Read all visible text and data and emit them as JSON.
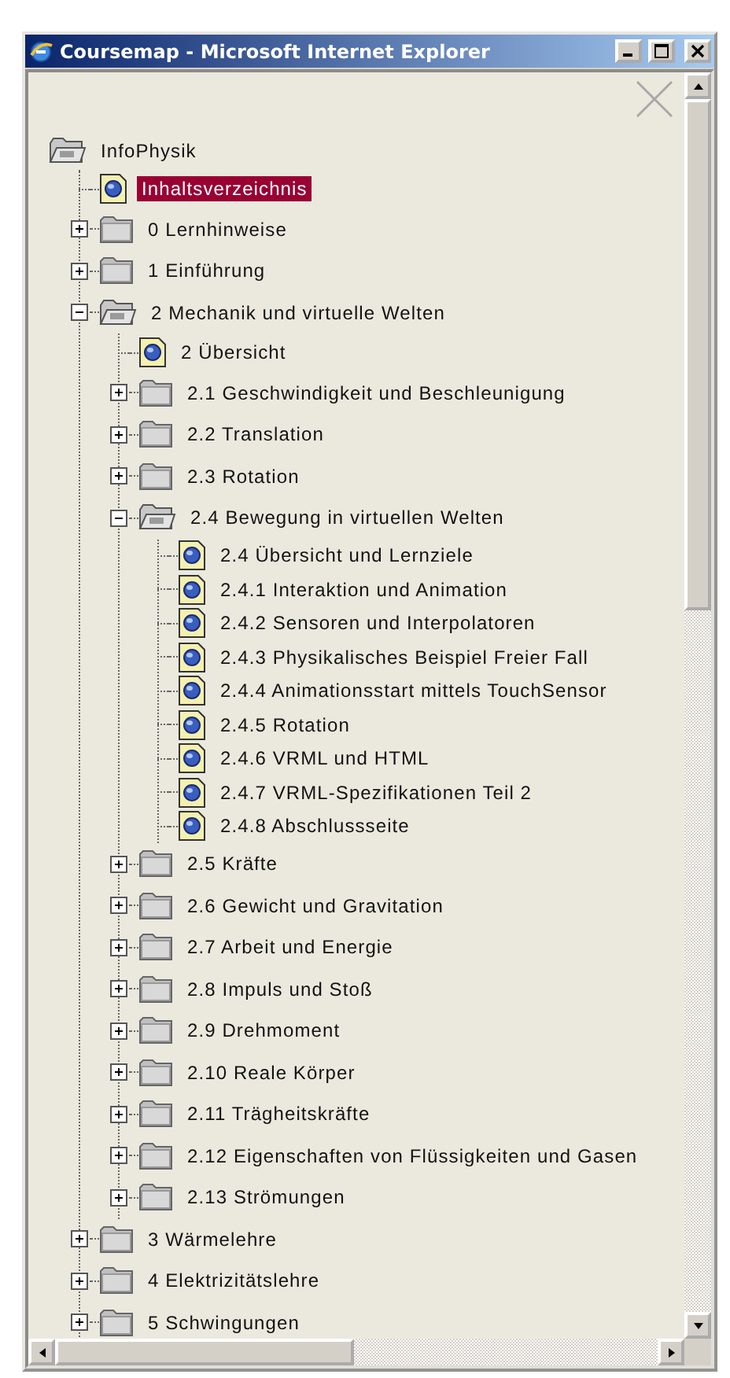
{
  "window": {
    "title": "Coursemap - Microsoft Internet Explorer"
  },
  "tree": {
    "label": "InfoPhysik",
    "kind": "folder",
    "expanded": true,
    "selected": false,
    "children": [
      {
        "label": "Inhaltsverzeichnis",
        "kind": "page",
        "selected": true
      },
      {
        "label": "0 Lernhinweise",
        "kind": "folder",
        "expanded": false,
        "selected": false
      },
      {
        "label": "1 Einführung",
        "kind": "folder",
        "expanded": false,
        "selected": false
      },
      {
        "label": "2 Mechanik und virtuelle Welten",
        "kind": "folder",
        "expanded": true,
        "selected": false,
        "children": [
          {
            "label": "2 Übersicht",
            "kind": "page",
            "selected": false
          },
          {
            "label": "2.1 Geschwindigkeit und Beschleunigung",
            "kind": "folder",
            "expanded": false,
            "selected": false
          },
          {
            "label": "2.2 Translation",
            "kind": "folder",
            "expanded": false,
            "selected": false
          },
          {
            "label": "2.3 Rotation",
            "kind": "folder",
            "expanded": false,
            "selected": false
          },
          {
            "label": "2.4 Bewegung in virtuellen Welten",
            "kind": "folder",
            "expanded": true,
            "selected": false,
            "children": [
              {
                "label": "2.4 Übersicht und Lernziele",
                "kind": "page",
                "selected": false
              },
              {
                "label": "2.4.1 Interaktion und Animation",
                "kind": "page",
                "selected": false
              },
              {
                "label": "2.4.2 Sensoren und Interpolatoren",
                "kind": "page",
                "selected": false
              },
              {
                "label": "2.4.3 Physikalisches Beispiel Freier Fall",
                "kind": "page",
                "selected": false
              },
              {
                "label": "2.4.4 Animationsstart mittels TouchSensor",
                "kind": "page",
                "selected": false
              },
              {
                "label": "2.4.5 Rotation",
                "kind": "page",
                "selected": false
              },
              {
                "label": "2.4.6 VRML und HTML",
                "kind": "page",
                "selected": false
              },
              {
                "label": "2.4.7 VRML-Spezifikationen Teil 2",
                "kind": "page",
                "selected": false
              },
              {
                "label": "2.4.8 Abschlussseite",
                "kind": "page",
                "selected": false
              }
            ]
          },
          {
            "label": "2.5 Kräfte",
            "kind": "folder",
            "expanded": false,
            "selected": false
          },
          {
            "label": "2.6 Gewicht und Gravitation",
            "kind": "folder",
            "expanded": false,
            "selected": false
          },
          {
            "label": "2.7 Arbeit und Energie",
            "kind": "folder",
            "expanded": false,
            "selected": false
          },
          {
            "label": "2.8 Impuls und Stoß",
            "kind": "folder",
            "expanded": false,
            "selected": false
          },
          {
            "label": "2.9 Drehmoment",
            "kind": "folder",
            "expanded": false,
            "selected": false
          },
          {
            "label": "2.10 Reale Körper",
            "kind": "folder",
            "expanded": false,
            "selected": false
          },
          {
            "label": "2.11 Trägheitskräfte",
            "kind": "folder",
            "expanded": false,
            "selected": false
          },
          {
            "label": "2.12 Eigenschaften von Flüssigkeiten und Gasen",
            "kind": "folder",
            "expanded": false,
            "selected": false
          },
          {
            "label": "2.13 Strömungen",
            "kind": "folder",
            "expanded": false,
            "selected": false
          }
        ]
      },
      {
        "label": "3 Wärmelehre",
        "kind": "folder",
        "expanded": false,
        "selected": false
      },
      {
        "label": "4 Elektrizitätslehre",
        "kind": "folder",
        "expanded": false,
        "selected": false
      },
      {
        "label": "5 Schwingungen",
        "kind": "folder",
        "expanded": false,
        "selected": false
      }
    ]
  }
}
